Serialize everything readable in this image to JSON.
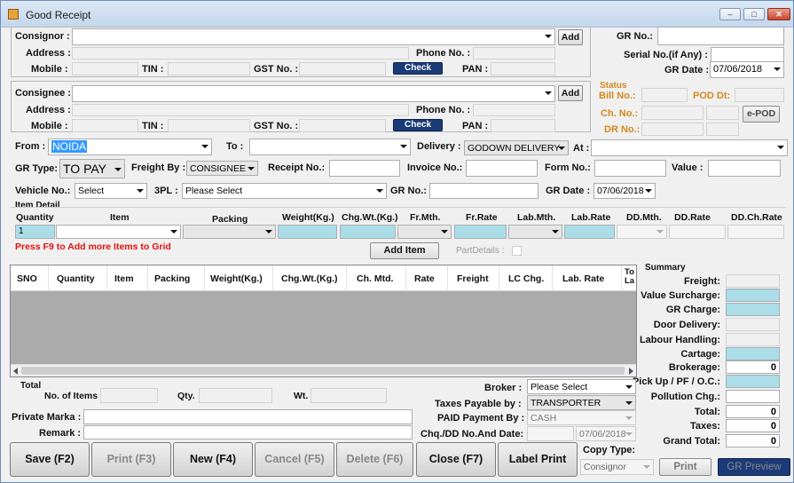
{
  "window": {
    "title": "Good Receipt",
    "min": "‒",
    "max": "□",
    "close": "✕"
  },
  "consignor": {
    "label": "Consignor :",
    "add": "Add",
    "address": "Address :",
    "phone": "Phone No. :",
    "mobile": "Mobile :",
    "tin": "TIN :",
    "gst": "GST No. :",
    "check": "Check",
    "pan": "PAN :"
  },
  "consignee": {
    "label": "Consignee :",
    "add": "Add",
    "address": "Address :",
    "phone": "Phone No. :",
    "mobile": "Mobile :",
    "tin": "TIN :",
    "gst": "GST No. :",
    "check": "Check",
    "pan": "PAN :"
  },
  "right": {
    "gr_no": "GR No.:",
    "serial": "Serial No.(if Any) :",
    "gr_date": "GR Date :",
    "gr_date_val": "07/06/2018",
    "status": "Status",
    "bill_no": "Bill No.:",
    "pod_dt": "POD Dt:",
    "ch_no": "Ch. No.:",
    "epod": "e-POD",
    "dr_no": "DR No.:"
  },
  "row1": {
    "from": "From :",
    "from_val": "NOIDA",
    "to": "To :",
    "delivery": "Delivery :",
    "delivery_val": "GODOWN DELIVERY",
    "at": "At :"
  },
  "row2": {
    "gr_type": "GR Type:",
    "gr_type_val": "TO PAY",
    "freight_by": "Freight By :",
    "freight_by_val": "CONSIGNEE",
    "receipt": "Receipt No.:",
    "invoice": "Invoice No.:",
    "form": "Form No.:",
    "value": "Value :"
  },
  "row3": {
    "vehicle": "Vehicle No.:",
    "vehicle_val": "Select",
    "tpl": "3PL :",
    "tpl_val": "Please Select",
    "gr_no": "GR No.:",
    "gr_date": "GR Date :",
    "gr_date_val": "07/06/2018"
  },
  "item": {
    "title": "Item Detail",
    "cols": [
      "Quantity",
      "Item",
      "Packing",
      "Weight(Kg.)",
      "Chg.Wt.(Kg.)",
      "Fr.Mth.",
      "Fr.Rate",
      "Lab.Mth.",
      "Lab.Rate",
      "DD.Mth.",
      "DD.Rate",
      "DD.Ch.Rate"
    ],
    "qty_val": "1",
    "hint": "Press F9 to Add more Items to Grid",
    "add_item": "Add Item",
    "part_details": "PartDetails :"
  },
  "grid": {
    "headers": [
      "SNO",
      "Quantity",
      "Item",
      "Packing",
      "Weight(Kg.)",
      "Chg.Wt.(Kg.)",
      "Ch. Mtd.",
      "Rate",
      "Freight",
      "LC Chg.",
      "Lab. Rate",
      "To La"
    ]
  },
  "summary": {
    "title": "Summary",
    "rows": [
      {
        "label": "Freight:",
        "value": ""
      },
      {
        "label": "Value Surcharge:",
        "value": ""
      },
      {
        "label": "GR Charge:",
        "value": ""
      },
      {
        "label": "Door Delivery:",
        "value": ""
      },
      {
        "label": "Labour Handling:",
        "value": ""
      },
      {
        "label": "Cartage:",
        "value": ""
      },
      {
        "label": "Brokerage:",
        "value": "0"
      },
      {
        "label": "Pick Up / PF / O.C.:",
        "value": ""
      },
      {
        "label": "Pollution Chg.:",
        "value": ""
      },
      {
        "label": "Total:",
        "value": "0"
      },
      {
        "label": "Taxes:",
        "value": "0"
      },
      {
        "label": "Grand Total:",
        "value": "0"
      }
    ]
  },
  "total": {
    "title": "Total",
    "items": "No. of Items",
    "qty": "Qty.",
    "wt": "Wt."
  },
  "lower": {
    "private_marka": "Private Marka :",
    "remark": "Remark :",
    "broker": "Broker :",
    "broker_val": "Please Select",
    "taxes_payable": "Taxes Payable by :",
    "taxes_payable_val": "TRANSPORTER",
    "paid_payment": "PAID Payment By :",
    "paid_payment_val": "CASH",
    "chq": "Chq./DD No.And Date:",
    "chq_date_val": "07/06/2018"
  },
  "buttons": {
    "save": "Save (F2)",
    "print": "Print (F3)",
    "new": "New  (F4)",
    "cancel": "Cancel (F5)",
    "delete": "Delete (F6)",
    "close": "Close (F7)",
    "label_print": "Label Print"
  },
  "copy": {
    "label": "Copy Type:",
    "val": "Consignor",
    "print": "Print",
    "gr_preview": "GR Preview"
  }
}
